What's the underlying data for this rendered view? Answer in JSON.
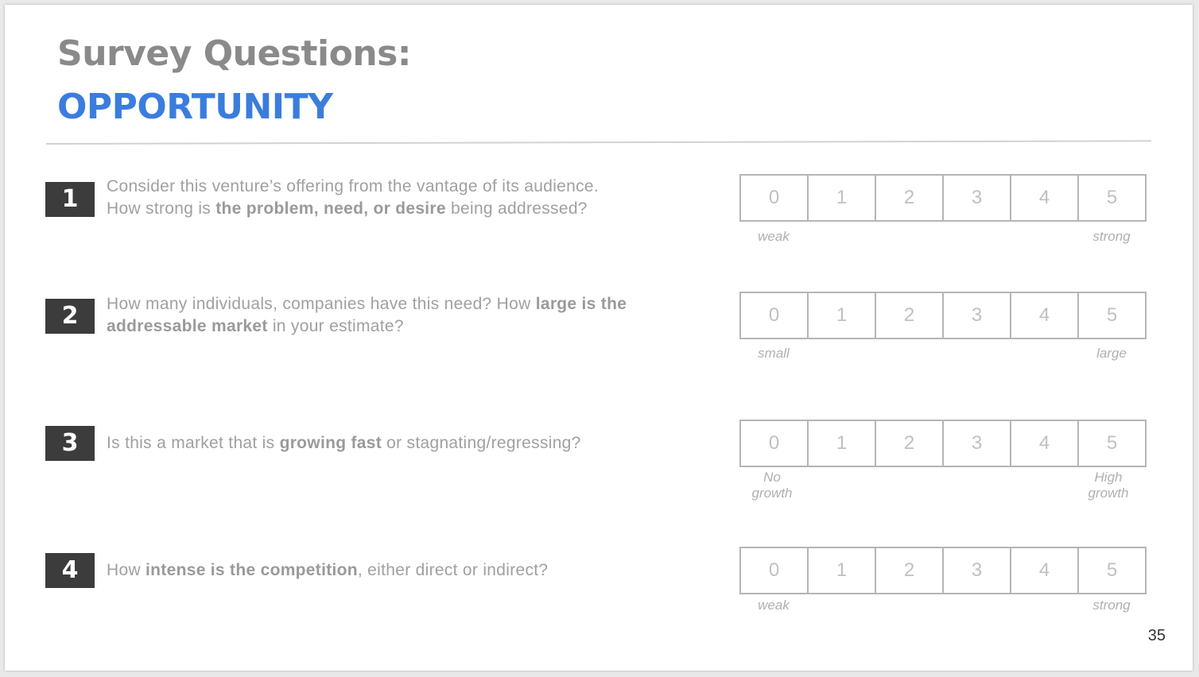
{
  "title": {
    "line1": "Survey Questions:",
    "line2": "OPPORTUNITY"
  },
  "colors": {
    "accent": "#3b7ddd",
    "title_gray": "#8a8a8a",
    "badge": "#3c3c3c"
  },
  "questions": [
    {
      "number": "1",
      "parts": [
        "Consider this venture’s offering from the vantage of its audience.",
        "How strong is ",
        "the problem, need, or desire",
        " being addressed?"
      ],
      "scale": [
        "0",
        "1",
        "2",
        "3",
        "4",
        "5"
      ],
      "low_label": "weak",
      "high_label": "strong"
    },
    {
      "number": "2",
      "parts": [
        "How many individuals, companies have this need?  How ",
        "large is the addressable market",
        " in your estimate?"
      ],
      "scale": [
        "0",
        "1",
        "2",
        "3",
        "4",
        "5"
      ],
      "low_label": "small",
      "high_label": "large"
    },
    {
      "number": "3",
      "parts": [
        "Is this a market that is ",
        "growing fast",
        " or stagnating/regressing?"
      ],
      "scale": [
        "0",
        "1",
        "2",
        "3",
        "4",
        "5"
      ],
      "low_label": "No growth",
      "high_label": "High growth"
    },
    {
      "number": "4",
      "parts": [
        "How ",
        "intense is the competition",
        ", either direct or indirect?"
      ],
      "scale": [
        "0",
        "1",
        "2",
        "3",
        "4",
        "5"
      ],
      "low_label": "weak",
      "high_label": "strong"
    }
  ],
  "page_number": "35"
}
